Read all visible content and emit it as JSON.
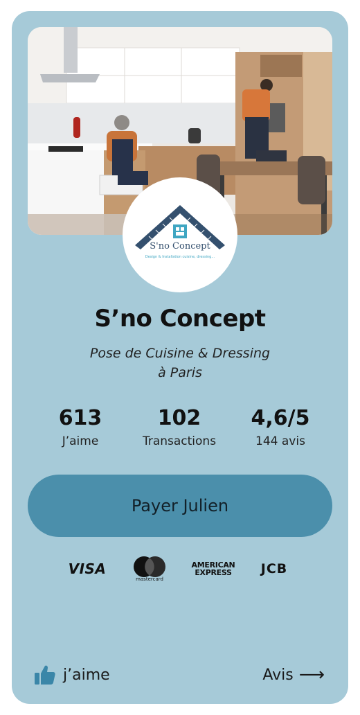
{
  "business": {
    "name": "S’no Concept",
    "tagline_line1": "Pose de Cuisine & Dressing",
    "tagline_line2": "à Paris",
    "logo_text": "S'no Concept",
    "logo_subtext": "Design & Installation cuisine, dressing..."
  },
  "stats": [
    {
      "value": "613",
      "label": "J’aime"
    },
    {
      "value": "102",
      "label": "Transactions"
    },
    {
      "value": "4,6/5",
      "label": "144 avis"
    }
  ],
  "pay_button": {
    "label": "Payer Julien"
  },
  "payment_methods": {
    "visa": "VISA",
    "mastercard": "mastercard",
    "amex_line1": "AMERICAN",
    "amex_line2": "EXPRESS",
    "jcb": "JCB"
  },
  "footer": {
    "like_label": "j’aime",
    "reviews_label": "Avis",
    "reviews_arrow": "⟶"
  },
  "colors": {
    "card_background": "#a6cad8",
    "button": "#4b8fab",
    "logo_navy": "#34506e",
    "logo_teal": "#3fa6c2",
    "like_icon": "#3a86a8"
  },
  "icons": {
    "like": "thumbs-up-icon",
    "reviews": "arrow-right-icon",
    "logo": "carpenter-square-house-logo"
  }
}
